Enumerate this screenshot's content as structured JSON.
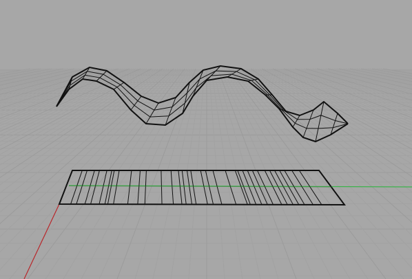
{
  "viewport": {
    "view": "perspective",
    "background_color": "#a7a7a7",
    "grid_color": "#9b9b9b",
    "grid_minor_color": "#a2a2a2",
    "x_axis_color": "#b9262a",
    "y_axis_color": "#3bb34a",
    "wire_color": "#111111"
  },
  "objects": [
    {
      "name": "wavy-surface",
      "type": "surface",
      "display": "wireframe"
    },
    {
      "name": "planar-surface",
      "type": "surface",
      "display": "wireframe"
    }
  ]
}
